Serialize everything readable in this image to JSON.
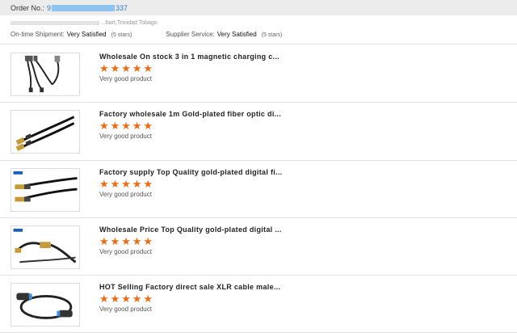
{
  "order": {
    "label": "Order No.:",
    "number_prefix": "9",
    "number_suffix": "337"
  },
  "meta": {
    "address": "...bart,Trinidad Tobago",
    "shipment_label": "On-time Shipment:",
    "shipment_value": "Very Satisfied",
    "shipment_stars": "(5 stars)",
    "service_label": "Supplier Service:",
    "service_value": "Very Satisfied",
    "service_stars": "(5 stars)"
  },
  "items": [
    {
      "title": "Wholesale On stock 3 in 1 magnetic charging c...",
      "rating": 5,
      "review": "Very good product",
      "icon": "usb-cable-image"
    },
    {
      "title": "Factory wholesale 1m Gold-plated fiber optic di...",
      "rating": 5,
      "review": "Very good product",
      "icon": "rca-cable-image"
    },
    {
      "title": "Factory supply Top Quality gold-plated digital fi...",
      "rating": 5,
      "review": "Very good product",
      "icon": "optical-cable-image"
    },
    {
      "title": "Wholesale Price Top Quality gold-plated digital ...",
      "rating": 5,
      "review": "Very good product",
      "icon": "coax-cable-image"
    },
    {
      "title": "HOT Selling Factory direct sale XLR cable male...",
      "rating": 5,
      "review": "Very good product",
      "icon": "xlr-cable-image"
    }
  ],
  "colors": {
    "star": "#f06a12",
    "link": "#2a7bd1"
  }
}
